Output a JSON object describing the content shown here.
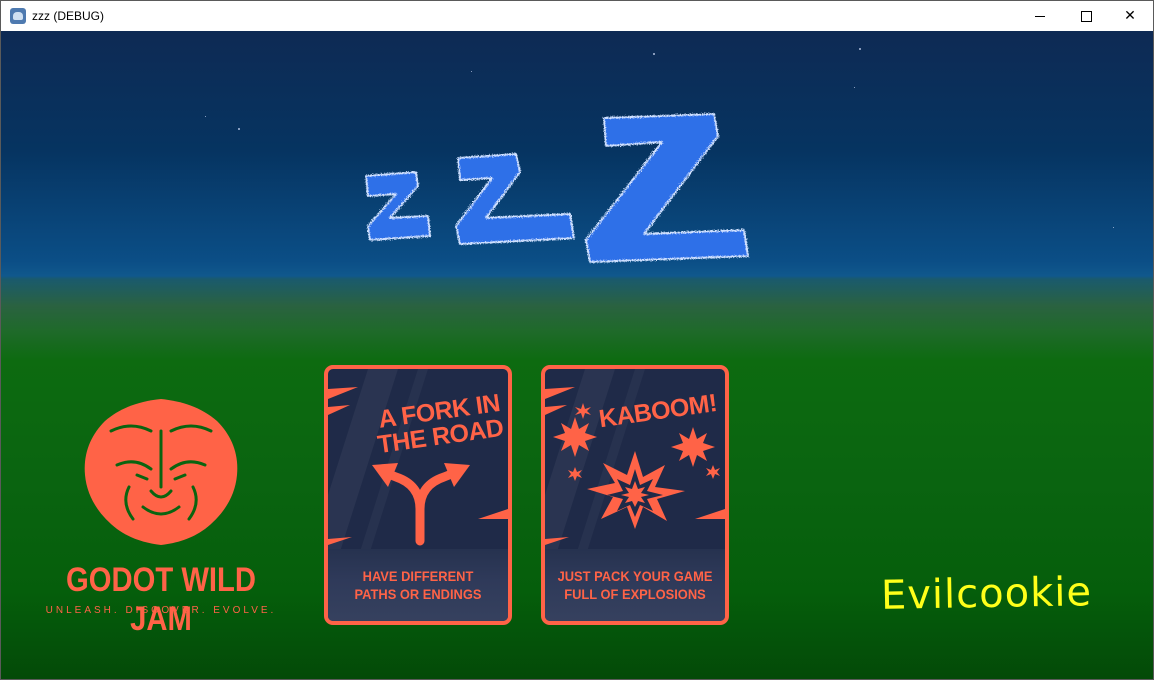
{
  "window": {
    "title": "zzz (DEBUG)",
    "controls": {
      "minimize": "minimize-icon",
      "maximize": "maximize-icon",
      "close": "close-icon"
    }
  },
  "game": {
    "logo": "zzZ",
    "jam": {
      "title": "GODOT WILD JAM",
      "tagline": "UNLEASH. DISCOVER. EVOLVE."
    },
    "cards": [
      {
        "title_line1": "A FORK IN",
        "title_line2": "THE ROAD",
        "desc_line1": "HAVE DIFFERENT",
        "desc_line2": "PATHS OR ENDINGS",
        "icon": "fork-arrows-icon"
      },
      {
        "title_line1": "KABOOM!",
        "title_line2": "",
        "desc_line1": "JUST PACK YOUR GAME",
        "desc_line2": "FULL OF EXPLOSIONS",
        "icon": "explosion-icon"
      }
    ],
    "signature": "Evilcookie"
  },
  "colors": {
    "accent": "#ff6347",
    "card_bg": "#1f2a48",
    "logo_blue": "#2f6fe8",
    "signature": "#ffff1a"
  }
}
